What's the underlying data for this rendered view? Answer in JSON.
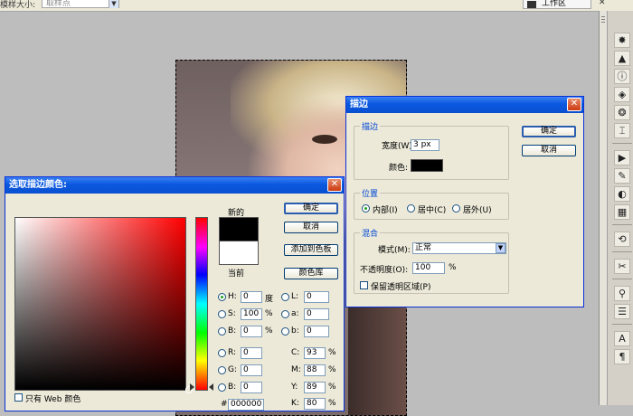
{
  "topbar": {
    "label": "模样大小:",
    "style_select": "取样点",
    "workspace": "工作区"
  },
  "stroke_dialog": {
    "title": "描边",
    "ok": "确定",
    "cancel": "取消",
    "stroke_group": {
      "title": "描边",
      "width_label": "宽度(W):",
      "width_value": "3 px",
      "color_label": "颜色:",
      "color": "#000000"
    },
    "position_group": {
      "title": "位置",
      "inside": "内部(I)",
      "center": "居中(C)",
      "outside": "居外(U)",
      "selected": "inside"
    },
    "blend_group": {
      "title": "混合",
      "mode_label": "模式(M):",
      "mode_value": "正常",
      "opacity_label": "不透明度(O):",
      "opacity_value": "100",
      "opacity_unit": "%",
      "preserve_label": "保留透明区域(P)"
    }
  },
  "picker_dialog": {
    "title": "选取描边颜色:",
    "ok": "确定",
    "cancel": "取消",
    "add_swatch": "添加到色板",
    "libraries": "颜色库",
    "new_label": "新的",
    "current_label": "当前",
    "new_color": "#000000",
    "current_color": "#ffffff",
    "web_only": "只有 Web 颜色",
    "hsb": {
      "h_label": "H:",
      "h_value": "0",
      "h_unit": "度",
      "s_label": "S:",
      "s_value": "100",
      "s_unit": "%",
      "b_label": "B:",
      "b_value": "0",
      "b_unit": "%"
    },
    "lab": {
      "l_label": "L:",
      "l_value": "0",
      "a_label": "a:",
      "a_value": "0",
      "b_label": "b:",
      "b_value": "0"
    },
    "rgb": {
      "r_label": "R:",
      "r_value": "0",
      "g_label": "G:",
      "g_value": "0",
      "b_label": "B:",
      "b_value": "0"
    },
    "cmyk": {
      "c_label": "C:",
      "c_value": "93",
      "m_label": "M:",
      "m_value": "88",
      "y_label": "Y:",
      "y_value": "89",
      "k_label": "K:",
      "k_value": "80",
      "unit": "%"
    },
    "hex_label": "#",
    "hex_value": "000000"
  },
  "tools": [
    "nav-icon",
    "histogram-icon",
    "info-icon",
    "layers-icon",
    "channels-icon",
    "paths-icon",
    "actions-icon",
    "brush-icon",
    "color-icon",
    "swatches-icon",
    "styles-icon",
    "tool-presets-icon",
    "history-icon",
    "character-icon",
    "paragraph-icon"
  ]
}
